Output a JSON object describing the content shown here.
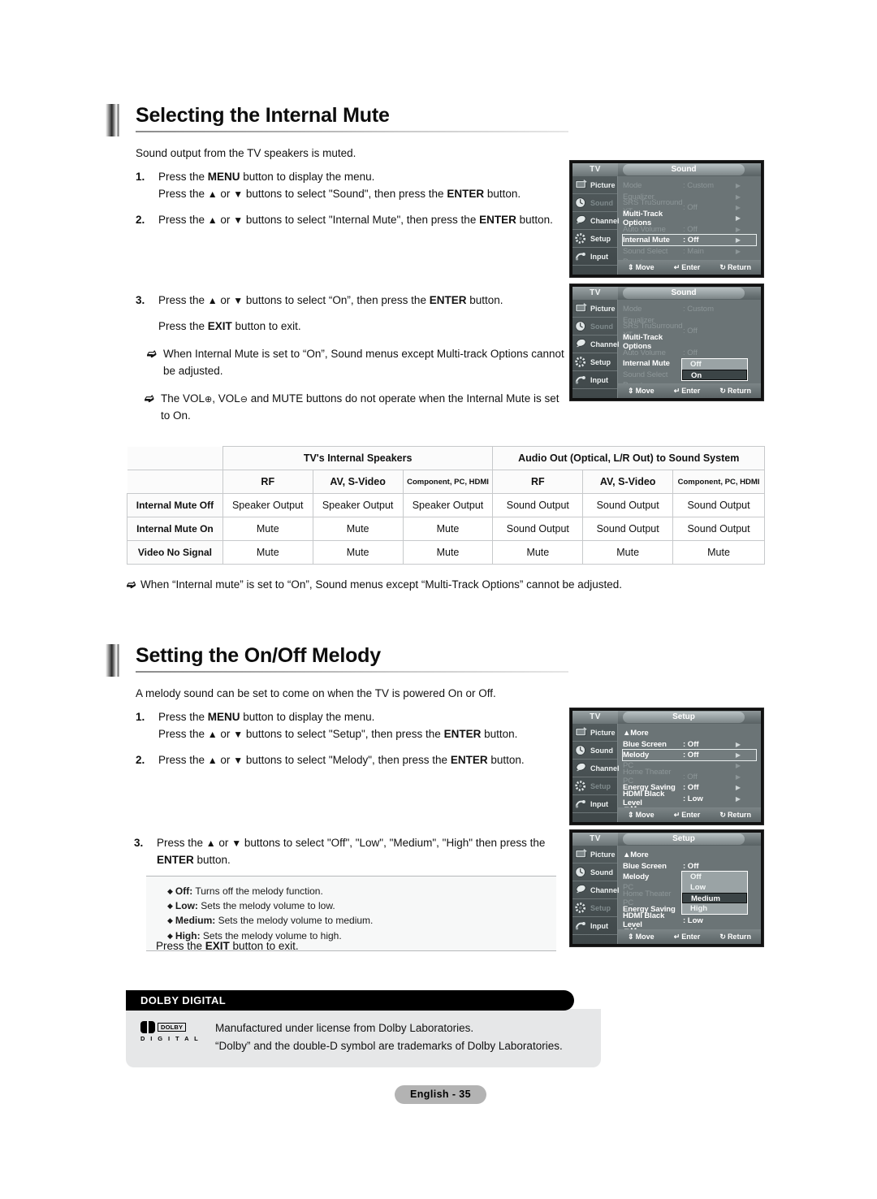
{
  "sections": [
    {
      "title": "Selecting the Internal Mute",
      "intro": "Sound output from the TV speakers is muted.",
      "steps": [
        {
          "num": "1.",
          "lines": [
            "Press the MENU button to display the menu.",
            "Press the ▲ or ▼ buttons to select \"Sound\", then press the ENTER button."
          ]
        },
        {
          "num": "2.",
          "lines": [
            "Press the ▲ or ▼ buttons to select \"Internal Mute\", then press the ENTER button."
          ]
        },
        {
          "num": "3.",
          "lines": [
            "Press the ▲ or ▼ buttons to select “On”, then press the ENTER button.",
            "Press the EXIT button to exit."
          ]
        }
      ],
      "notes": [
        "When Internal Mute is set to “On”, Sound menus except Multi-track Options cannot be adjusted.",
        "The VOL⊕, VOL⊖ and MUTE buttons do not operate when the Internal Mute is set to On."
      ]
    },
    {
      "title": "Setting the On/Off Melody",
      "intro": "A melody sound can be set to come on when the TV is powered On or Off.",
      "steps": [
        {
          "num": "1.",
          "lines": [
            "Press the MENU button to display the menu.",
            "Press the ▲ or ▼ buttons to select \"Setup\", then press the ENTER button."
          ]
        },
        {
          "num": "2.",
          "lines": [
            "Press the ▲ or ▼ buttons to select \"Melody\", then press the ENTER button."
          ]
        },
        {
          "num": "3.",
          "lines": [
            "Press the ▲ or ▼ buttons to select \"Off\", \"Low\", \"Medium\", \"High\" then press the",
            "ENTER button."
          ]
        }
      ],
      "exit_line": "Press the EXIT button to exit."
    }
  ],
  "melody_options": [
    {
      "term": "Off:",
      "desc": "Turns off the melody function."
    },
    {
      "term": "Low:",
      "desc": "Sets the melody volume to low."
    },
    {
      "term": "Medium:",
      "desc": "Sets the melody volume to medium."
    },
    {
      "term": "High:",
      "desc": "Sets the melody volume to high."
    }
  ],
  "table": {
    "group_headers": [
      "",
      "TV's Internal Speakers",
      "Audio Out (Optical, L/R Out) to Sound System"
    ],
    "sub_headers": [
      "RF",
      "AV, S-Video",
      "Component, PC, HDMI",
      "RF",
      "AV, S-Video",
      "Component, PC, HDMI"
    ],
    "rows": [
      {
        "label": "Internal Mute Off",
        "cells": [
          "Speaker Output",
          "Speaker Output",
          "Speaker Output",
          "Sound Output",
          "Sound Output",
          "Sound Output"
        ]
      },
      {
        "label": "Internal Mute On",
        "cells": [
          "Mute",
          "Mute",
          "Mute",
          "Sound Output",
          "Sound Output",
          "Sound Output"
        ]
      },
      {
        "label": "Video No Signal",
        "cells": [
          "Mute",
          "Mute",
          "Mute",
          "Mute",
          "Mute",
          "Mute"
        ]
      }
    ],
    "footnote": "When “Internal mute” is set to “On”, Sound menus except “Multi-Track Options” cannot be adjusted."
  },
  "osd_common": {
    "tv_label": "TV",
    "sidebar": [
      {
        "label": "Picture",
        "icon": "picture-icon"
      },
      {
        "label": "Sound",
        "icon": "sound-icon"
      },
      {
        "label": "Channel",
        "icon": "channel-icon"
      },
      {
        "label": "Setup",
        "icon": "setup-icon"
      },
      {
        "label": "Input",
        "icon": "input-icon"
      }
    ],
    "bottom": {
      "move": "Move",
      "enter": "Enter",
      "return": "Return"
    }
  },
  "osd1": {
    "title": "Sound",
    "active_sidebar": "Sound",
    "rows": [
      {
        "name": "Mode",
        "value": ": Custom",
        "arrow": "▶",
        "style": "dimmed"
      },
      {
        "name": "Equalizer",
        "value": "",
        "arrow": "▶",
        "style": "dimmed"
      },
      {
        "name": "SRS TruSurround XT",
        "value": ": Off",
        "arrow": "▶",
        "style": "dimmed"
      },
      {
        "name": "Multi-Track Options",
        "value": "",
        "arrow": "▶",
        "style": "bold"
      },
      {
        "name": "Auto Volume",
        "value": ": Off",
        "arrow": "▶",
        "style": "dimmed"
      },
      {
        "name": "Internal Mute",
        "value": ": Off",
        "arrow": "▶",
        "style": "sel"
      },
      {
        "name": "Sound Select",
        "value": ": Main",
        "arrow": "▶",
        "style": "dimmed"
      },
      {
        "name": "Reset",
        "value": "",
        "arrow": "",
        "style": "dimmed"
      }
    ]
  },
  "osd2": {
    "title": "Sound",
    "active_sidebar": "Sound",
    "rows": [
      {
        "name": "Mode",
        "value": ": Custom",
        "arrow": "",
        "style": "dimmed"
      },
      {
        "name": "Equalizer",
        "value": "",
        "arrow": "",
        "style": "dimmed"
      },
      {
        "name": "SRS TruSurround XT",
        "value": ": Off",
        "arrow": "",
        "style": "dimmed"
      },
      {
        "name": "Multi-Track Options",
        "value": "",
        "arrow": "",
        "style": "bold"
      },
      {
        "name": "Auto Volume",
        "value": ": Off",
        "arrow": "",
        "style": "dimmed"
      },
      {
        "name": "Internal Mute",
        "value": ":",
        "arrow": "",
        "style": "hl-name"
      },
      {
        "name": "Sound Select",
        "value": ":",
        "arrow": "",
        "style": "dimmed"
      },
      {
        "name": "Reset",
        "value": "",
        "arrow": "",
        "style": "dimmed"
      }
    ],
    "popup": {
      "options": [
        "Off",
        "On"
      ],
      "selected": "On"
    }
  },
  "osd3": {
    "title": "Setup",
    "active_sidebar": "Setup",
    "rows": [
      {
        "name": "▲More",
        "value": "",
        "arrow": "",
        "style": "bold"
      },
      {
        "name": "Blue Screen",
        "value": ": Off",
        "arrow": "▶",
        "style": "bold"
      },
      {
        "name": "Melody",
        "value": ": Off",
        "arrow": "▶",
        "style": "sel"
      },
      {
        "name": "PC",
        "value": "",
        "arrow": "▶",
        "style": "dimmed"
      },
      {
        "name": "Home Theater PC",
        "value": ": Off",
        "arrow": "▶",
        "style": "dimmed"
      },
      {
        "name": "Energy Saving",
        "value": ": Off",
        "arrow": "▶",
        "style": "bold"
      },
      {
        "name": "HDMI Black Level",
        "value": ": Low",
        "arrow": "▶",
        "style": "bold"
      },
      {
        "name": "▼More",
        "value": "",
        "arrow": "",
        "style": "bold"
      }
    ]
  },
  "osd4": {
    "title": "Setup",
    "active_sidebar": "Setup",
    "rows": [
      {
        "name": "▲More",
        "value": "",
        "arrow": "",
        "style": "bold"
      },
      {
        "name": "Blue Screen",
        "value": ": Off",
        "arrow": "",
        "style": "bold"
      },
      {
        "name": "Melody",
        "value": ":",
        "arrow": "",
        "style": "bold"
      },
      {
        "name": "PC",
        "value": "",
        "arrow": "",
        "style": "dimmed"
      },
      {
        "name": "Home Theater PC",
        "value": ":",
        "arrow": "",
        "style": "dimmed"
      },
      {
        "name": "Energy Saving",
        "value": ": Off",
        "arrow": "",
        "style": "bold"
      },
      {
        "name": "HDMI Black Level",
        "value": ": Low",
        "arrow": "",
        "style": "bold"
      },
      {
        "name": "▼More",
        "value": "",
        "arrow": "",
        "style": "bold"
      }
    ],
    "popup": {
      "options": [
        "Off",
        "Low",
        "Medium",
        "High"
      ],
      "selected": "Medium"
    }
  },
  "dolby": {
    "header": "DOLBY DIGITAL",
    "logo_word": "DOLBY",
    "logo_sub": "D I G I T A L",
    "lines": [
      "Manufactured under license from Dolby Laboratories.",
      "“Dolby” and the double-D symbol are trademarks of Dolby Laboratories."
    ]
  },
  "footer": {
    "page": "English - 35"
  }
}
